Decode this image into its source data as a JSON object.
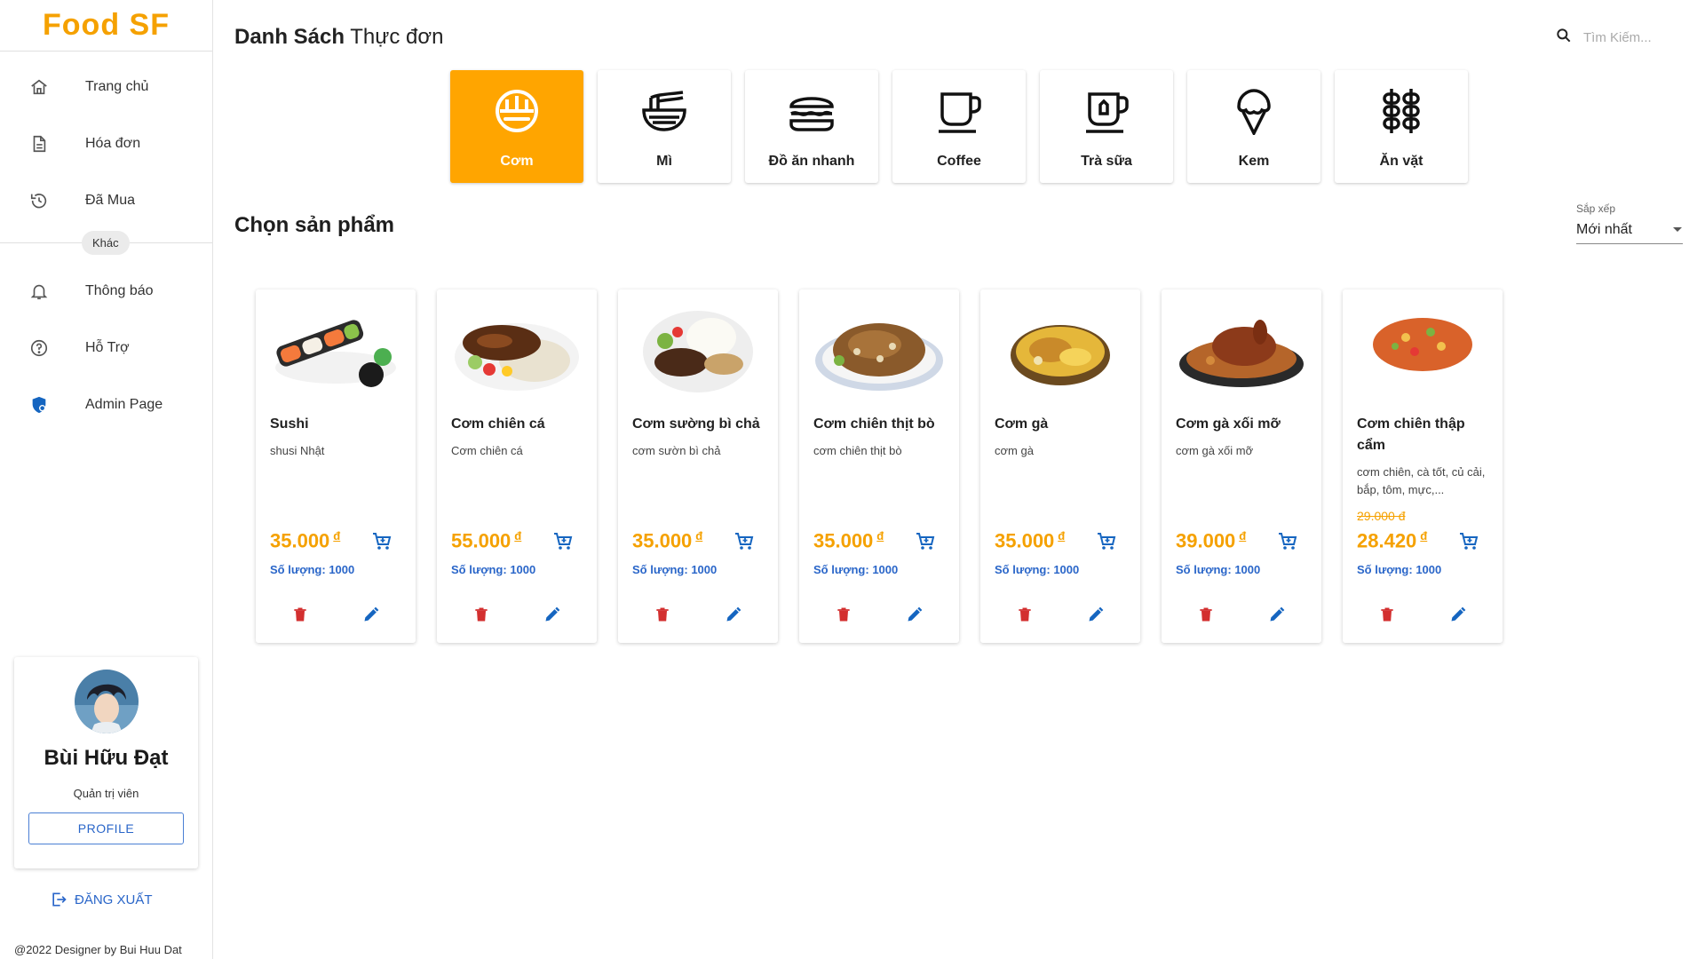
{
  "app": {
    "logo": "Food SF"
  },
  "sidebar": {
    "items": [
      {
        "label": "Trang chủ",
        "icon": "home-icon"
      },
      {
        "label": "Hóa đơn",
        "icon": "receipt-icon"
      },
      {
        "label": "Đã Mua",
        "icon": "history-icon"
      }
    ],
    "divider_label": "Khác",
    "items2": [
      {
        "label": "Thông báo",
        "icon": "bell-icon"
      },
      {
        "label": "Hỗ Trợ",
        "icon": "help-icon"
      },
      {
        "label": "Admin Page",
        "icon": "admin-shield-icon"
      }
    ]
  },
  "user": {
    "name": "Bùi Hữu Đạt",
    "role": "Quản trị viên",
    "profile_button": "PROFILE"
  },
  "logout_label": "ĐĂNG XUẤT",
  "footer": "@2022 Designer by Bui Huu Dat",
  "header": {
    "title_bold": "Danh Sách",
    "title_rest": " Thực đơn",
    "search_placeholder": "Tìm Kiếm..."
  },
  "categories": [
    {
      "label": "Cơm",
      "icon": "rice-bowl-icon",
      "active": true
    },
    {
      "label": "Mì",
      "icon": "noodle-bowl-icon",
      "active": false
    },
    {
      "label": "Đồ ăn nhanh",
      "icon": "burger-icon",
      "active": false
    },
    {
      "label": "Coffee",
      "icon": "coffee-cup-icon",
      "active": false
    },
    {
      "label": "Trà sữa",
      "icon": "milk-tea-icon",
      "active": false
    },
    {
      "label": "Kem",
      "icon": "ice-cream-icon",
      "active": false
    },
    {
      "label": "Ăn vặt",
      "icon": "skewer-icon",
      "active": false
    }
  ],
  "section_title": "Chọn sản phẩm",
  "sort": {
    "label": "Sắp xếp",
    "value": "Mới nhất"
  },
  "products": [
    {
      "name": "Sushi",
      "desc": "shusi Nhật",
      "price": "35.000",
      "old_price": "",
      "currency": "đ",
      "qty": "Số lượng: 1000"
    },
    {
      "name": "Cơm chiên cá",
      "desc": "Cơm chiên cá",
      "price": "55.000",
      "old_price": "",
      "currency": "đ",
      "qty": "Số lượng: 1000"
    },
    {
      "name": "Cơm sường bì chả",
      "desc": "cơm sườn bì chả",
      "price": "35.000",
      "old_price": "",
      "currency": "đ",
      "qty": "Số lượng: 1000"
    },
    {
      "name": "Cơm chiên thịt bò",
      "desc": "cơm chiên thịt bò",
      "price": "35.000",
      "old_price": "",
      "currency": "đ",
      "qty": "Số lượng: 1000"
    },
    {
      "name": "Cơm gà",
      "desc": "cơm gà",
      "price": "35.000",
      "old_price": "",
      "currency": "đ",
      "qty": "Số lượng: 1000"
    },
    {
      "name": "Cơm gà xối mỡ",
      "desc": "cơm gà xối mỡ",
      "price": "39.000",
      "old_price": "",
      "currency": "đ",
      "qty": "Số lượng: 1000"
    },
    {
      "name": "Cơm chiên thập cẩm",
      "desc": "cơm chiên, cà tốt, củ cải, bắp, tôm, mực,...",
      "price": "28.420",
      "old_price": "29.000 đ",
      "currency": "đ",
      "qty": "Số lượng: 1000"
    }
  ],
  "colors": {
    "accent": "#ffa500",
    "link": "#2a66c9",
    "delete": "#d32f2f"
  }
}
